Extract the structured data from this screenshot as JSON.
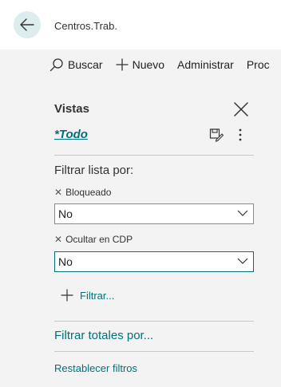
{
  "header": {
    "title": "Centros.Trab."
  },
  "toolbar": {
    "buscar": "Buscar",
    "nuevo": "Nuevo",
    "administrar": "Administrar",
    "proc": "Proc"
  },
  "views": {
    "title": "Vistas",
    "current": "*Todo"
  },
  "filters": {
    "heading": "Filtrar lista por:",
    "items": [
      {
        "label": "Bloqueado",
        "value": "No"
      },
      {
        "label": "Ocultar en CDP",
        "value": "No"
      }
    ],
    "add_label": "Filtrar..."
  },
  "totals": {
    "label": "Filtrar totales por..."
  },
  "reset": {
    "label": "Restablecer filtros"
  },
  "colors": {
    "accent": "#00717a",
    "back_bg": "#dcecef"
  }
}
